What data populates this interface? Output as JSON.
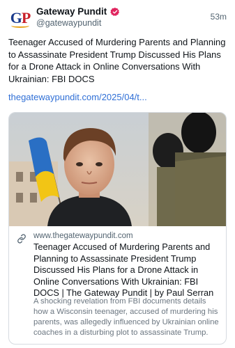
{
  "post": {
    "author": {
      "display_name": "Gateway Pundit",
      "handle": "@gatewaypundit",
      "avatar_text": "GP",
      "verified": true
    },
    "time": "53m",
    "text": "Teenager Accused of Murdering Parents and Planning to Assassinate President Trump Discussed His Plans for a Drone Attack in Online Conversations With Ukrainian: FBI DOCS",
    "link_text": "thegatewaypundit.com/2025/04/t..."
  },
  "card": {
    "domain": "www.thegatewaypundit.com",
    "title": "Teenager Accused of Murdering Parents and Planning to Assassinate President Trump Discussed His Plans for a Drone Attack in Online Conversations With Ukrainian: FBI DOCS | The Gateway Pundit | by Paul Serran",
    "description": "A shocking revelation from FBI documents details how a Wisconsin teenager, accused of murdering his parents, was allegedly influenced by Ukrainian online coaches in a disturbing plot to assassinate Trump.",
    "icon": "link-icon"
  },
  "colors": {
    "link": "#2f6fd6",
    "verified_badge": "#e0245e",
    "muted_text": "#536471",
    "avatar_blue": "#1a3a8c",
    "avatar_red": "#c8202a"
  }
}
